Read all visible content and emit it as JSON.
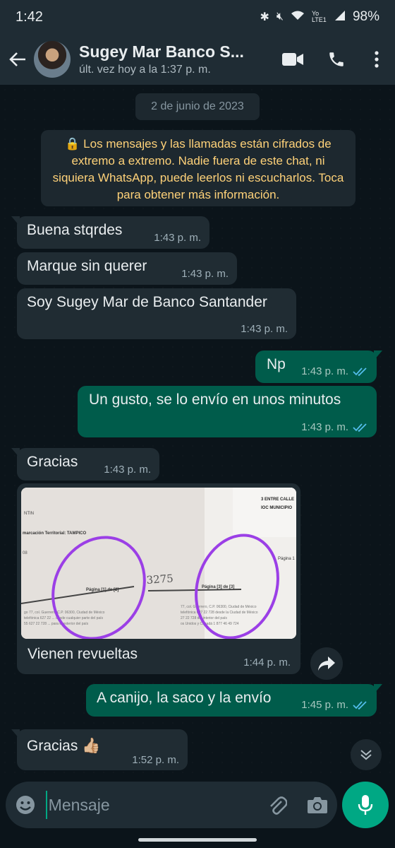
{
  "status_bar": {
    "time": "1:42",
    "network_label": "Yo LTE1",
    "battery": "98%"
  },
  "header": {
    "contact_name": "Sugey Mar Banco S...",
    "last_seen": "últ. vez hoy a la 1:37 p. m."
  },
  "chat": {
    "date_chip": "2 de junio de 2023",
    "encryption_notice": "🔒 Los mensajes y las llamadas están cifrados de extremo a extremo. Nadie fuera de este chat, ni siquiera WhatsApp, puede leerlos ni escucharlos. Toca para obtener más información.",
    "messages": [
      {
        "direction": "in",
        "text": "Buena stqrdes",
        "time": "1:43 p. m."
      },
      {
        "direction": "in",
        "text": "Marque sin querer",
        "time": "1:43 p. m."
      },
      {
        "direction": "in",
        "text": "Soy Sugey Mar de Banco Santander",
        "time": "1:43 p. m."
      },
      {
        "direction": "out",
        "text": "Np",
        "time": "1:43 p. m.",
        "status": "read"
      },
      {
        "direction": "out",
        "text": "Un gusto, se lo envío en unos minutos",
        "time": "1:43 p. m.",
        "status": "read"
      },
      {
        "direction": "in",
        "text": "Gracias",
        "time": "1:43 p. m."
      },
      {
        "direction": "in",
        "type": "image",
        "text": "Vienen revueltas",
        "time": "1:44 p. m.",
        "photo_text": {
          "line1": "marcación Territorial: TAMPICO",
          "page_left": "Página [1] de [2]",
          "page_right": "Página [3] de [3]",
          "handwritten": "3275",
          "right_header": "3 ENTRE CALLE",
          "right_sub": "IOC MUNICIPIO",
          "page_far": "Página 1"
        }
      },
      {
        "direction": "out",
        "text": "A canijo, la saco y la envío",
        "time": "1:45 p. m.",
        "status": "read"
      },
      {
        "direction": "in",
        "text": "Gracias 👍🏼",
        "time": "1:52 p. m."
      }
    ]
  },
  "composer": {
    "placeholder": "Mensaje"
  },
  "colors": {
    "background": "#0b141a",
    "incoming_bubble": "#202c33",
    "outgoing_bubble": "#005c4b",
    "accent": "#00a884",
    "read_ticks": "#53bdeb",
    "notice_text": "#ffd279"
  },
  "icons": [
    "back-arrow-icon",
    "video-call-icon",
    "phone-icon",
    "more-vert-icon",
    "forward-icon",
    "chevron-down-icon",
    "emoji-icon",
    "attach-icon",
    "camera-icon",
    "mic-icon",
    "double-check-icon"
  ]
}
